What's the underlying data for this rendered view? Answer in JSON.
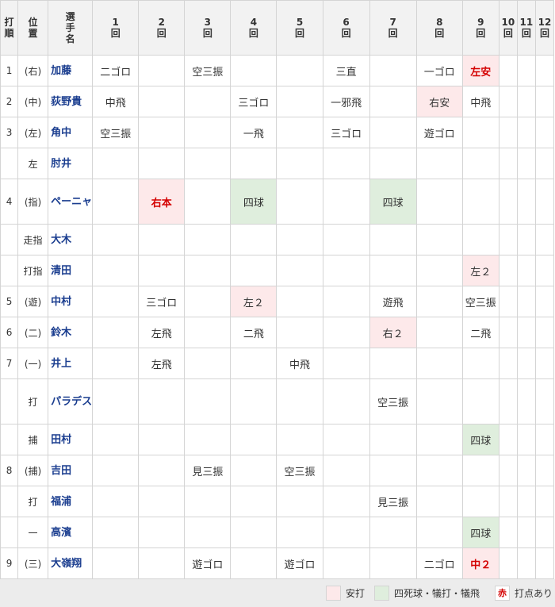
{
  "header": {
    "order": [
      "打",
      "順"
    ],
    "pos": [
      "位",
      "置"
    ],
    "name": [
      "選",
      "手",
      "名"
    ],
    "innings": [
      [
        "1",
        "回"
      ],
      [
        "2",
        "回"
      ],
      [
        "3",
        "回"
      ],
      [
        "4",
        "回"
      ],
      [
        "5",
        "回"
      ],
      [
        "6",
        "回"
      ],
      [
        "7",
        "回"
      ],
      [
        "8",
        "回"
      ],
      [
        "9",
        "回"
      ],
      [
        "10",
        "回"
      ],
      [
        "11",
        "回"
      ],
      [
        "12",
        "回"
      ]
    ]
  },
  "rows": [
    {
      "order": "1",
      "pos": "(右)",
      "name": "加藤",
      "tall": false,
      "cells": [
        {
          "t": "二ゴロ"
        },
        {
          "t": ""
        },
        {
          "t": "空三振"
        },
        {
          "t": ""
        },
        {
          "t": ""
        },
        {
          "t": "三直"
        },
        {
          "t": ""
        },
        {
          "t": "一ゴロ"
        },
        {
          "t": "左安",
          "k": "hit",
          "rbi": true
        },
        {
          "t": ""
        },
        {
          "t": ""
        },
        {
          "t": ""
        }
      ]
    },
    {
      "order": "2",
      "pos": "(中)",
      "name": "荻野貴",
      "tall": false,
      "cells": [
        {
          "t": "中飛"
        },
        {
          "t": ""
        },
        {
          "t": ""
        },
        {
          "t": "三ゴロ"
        },
        {
          "t": ""
        },
        {
          "t": "一邪飛"
        },
        {
          "t": ""
        },
        {
          "t": "右安",
          "k": "hit"
        },
        {
          "t": "中飛"
        },
        {
          "t": ""
        },
        {
          "t": ""
        },
        {
          "t": ""
        }
      ]
    },
    {
      "order": "3",
      "pos": "(左)",
      "name": "角中",
      "tall": false,
      "cells": [
        {
          "t": "空三振"
        },
        {
          "t": ""
        },
        {
          "t": ""
        },
        {
          "t": "一飛"
        },
        {
          "t": ""
        },
        {
          "t": "三ゴロ"
        },
        {
          "t": ""
        },
        {
          "t": "遊ゴロ"
        },
        {
          "t": ""
        },
        {
          "t": ""
        },
        {
          "t": ""
        },
        {
          "t": ""
        }
      ]
    },
    {
      "order": "",
      "pos": "左",
      "name": "肘井",
      "tall": false,
      "cells": [
        {
          "t": ""
        },
        {
          "t": ""
        },
        {
          "t": ""
        },
        {
          "t": ""
        },
        {
          "t": ""
        },
        {
          "t": ""
        },
        {
          "t": ""
        },
        {
          "t": ""
        },
        {
          "t": ""
        },
        {
          "t": ""
        },
        {
          "t": ""
        },
        {
          "t": ""
        }
      ]
    },
    {
      "order": "4",
      "pos": "(指)",
      "name": "ペーニャ",
      "tall": true,
      "cells": [
        {
          "t": ""
        },
        {
          "t": "右本",
          "k": "hit",
          "rbi": true
        },
        {
          "t": ""
        },
        {
          "t": "四球",
          "k": "walk"
        },
        {
          "t": ""
        },
        {
          "t": ""
        },
        {
          "t": "四球",
          "k": "walk"
        },
        {
          "t": ""
        },
        {
          "t": ""
        },
        {
          "t": ""
        },
        {
          "t": ""
        },
        {
          "t": ""
        }
      ]
    },
    {
      "order": "",
      "pos": "走指",
      "name": "大木",
      "tall": false,
      "cells": [
        {
          "t": ""
        },
        {
          "t": ""
        },
        {
          "t": ""
        },
        {
          "t": ""
        },
        {
          "t": ""
        },
        {
          "t": ""
        },
        {
          "t": ""
        },
        {
          "t": ""
        },
        {
          "t": ""
        },
        {
          "t": ""
        },
        {
          "t": ""
        },
        {
          "t": ""
        }
      ]
    },
    {
      "order": "",
      "pos": "打指",
      "name": "清田",
      "tall": false,
      "cells": [
        {
          "t": ""
        },
        {
          "t": ""
        },
        {
          "t": ""
        },
        {
          "t": ""
        },
        {
          "t": ""
        },
        {
          "t": ""
        },
        {
          "t": ""
        },
        {
          "t": ""
        },
        {
          "t": "左２",
          "k": "hit"
        },
        {
          "t": ""
        },
        {
          "t": ""
        },
        {
          "t": ""
        }
      ]
    },
    {
      "order": "5",
      "pos": "(遊)",
      "name": "中村",
      "tall": false,
      "cells": [
        {
          "t": ""
        },
        {
          "t": "三ゴロ"
        },
        {
          "t": ""
        },
        {
          "t": "左２",
          "k": "hit"
        },
        {
          "t": ""
        },
        {
          "t": ""
        },
        {
          "t": "遊飛"
        },
        {
          "t": ""
        },
        {
          "t": "空三振"
        },
        {
          "t": ""
        },
        {
          "t": ""
        },
        {
          "t": ""
        }
      ]
    },
    {
      "order": "6",
      "pos": "(二)",
      "name": "鈴木",
      "tall": false,
      "cells": [
        {
          "t": ""
        },
        {
          "t": "左飛"
        },
        {
          "t": ""
        },
        {
          "t": "二飛"
        },
        {
          "t": ""
        },
        {
          "t": ""
        },
        {
          "t": "右２",
          "k": "hit"
        },
        {
          "t": ""
        },
        {
          "t": "二飛"
        },
        {
          "t": ""
        },
        {
          "t": ""
        },
        {
          "t": ""
        }
      ]
    },
    {
      "order": "7",
      "pos": "(一)",
      "name": "井上",
      "tall": false,
      "cells": [
        {
          "t": ""
        },
        {
          "t": "左飛"
        },
        {
          "t": ""
        },
        {
          "t": ""
        },
        {
          "t": "中飛"
        },
        {
          "t": ""
        },
        {
          "t": ""
        },
        {
          "t": ""
        },
        {
          "t": ""
        },
        {
          "t": ""
        },
        {
          "t": ""
        },
        {
          "t": ""
        }
      ]
    },
    {
      "order": "",
      "pos": "打",
      "name": "パラデス",
      "tall": true,
      "cells": [
        {
          "t": ""
        },
        {
          "t": ""
        },
        {
          "t": ""
        },
        {
          "t": ""
        },
        {
          "t": ""
        },
        {
          "t": ""
        },
        {
          "t": "空三振"
        },
        {
          "t": ""
        },
        {
          "t": ""
        },
        {
          "t": ""
        },
        {
          "t": ""
        },
        {
          "t": ""
        }
      ]
    },
    {
      "order": "",
      "pos": "捕",
      "name": "田村",
      "tall": false,
      "cells": [
        {
          "t": ""
        },
        {
          "t": ""
        },
        {
          "t": ""
        },
        {
          "t": ""
        },
        {
          "t": ""
        },
        {
          "t": ""
        },
        {
          "t": ""
        },
        {
          "t": ""
        },
        {
          "t": "四球",
          "k": "walk"
        },
        {
          "t": ""
        },
        {
          "t": ""
        },
        {
          "t": ""
        }
      ]
    },
    {
      "order": "8",
      "pos": "(捕)",
      "name": "吉田",
      "tall": false,
      "cells": [
        {
          "t": ""
        },
        {
          "t": ""
        },
        {
          "t": "見三振"
        },
        {
          "t": ""
        },
        {
          "t": "空三振"
        },
        {
          "t": ""
        },
        {
          "t": ""
        },
        {
          "t": ""
        },
        {
          "t": ""
        },
        {
          "t": ""
        },
        {
          "t": ""
        },
        {
          "t": ""
        }
      ]
    },
    {
      "order": "",
      "pos": "打",
      "name": "福浦",
      "tall": false,
      "cells": [
        {
          "t": ""
        },
        {
          "t": ""
        },
        {
          "t": ""
        },
        {
          "t": ""
        },
        {
          "t": ""
        },
        {
          "t": ""
        },
        {
          "t": "見三振"
        },
        {
          "t": ""
        },
        {
          "t": ""
        },
        {
          "t": ""
        },
        {
          "t": ""
        },
        {
          "t": ""
        }
      ]
    },
    {
      "order": "",
      "pos": "一",
      "name": "高濱",
      "tall": false,
      "cells": [
        {
          "t": ""
        },
        {
          "t": ""
        },
        {
          "t": ""
        },
        {
          "t": ""
        },
        {
          "t": ""
        },
        {
          "t": ""
        },
        {
          "t": ""
        },
        {
          "t": ""
        },
        {
          "t": "四球",
          "k": "walk"
        },
        {
          "t": ""
        },
        {
          "t": ""
        },
        {
          "t": ""
        }
      ]
    },
    {
      "order": "9",
      "pos": "(三)",
      "name": "大嶺翔",
      "tall": false,
      "cells": [
        {
          "t": ""
        },
        {
          "t": ""
        },
        {
          "t": "遊ゴロ"
        },
        {
          "t": ""
        },
        {
          "t": "遊ゴロ"
        },
        {
          "t": ""
        },
        {
          "t": ""
        },
        {
          "t": "二ゴロ"
        },
        {
          "t": "中２",
          "k": "hit",
          "rbi": true
        },
        {
          "t": ""
        },
        {
          "t": ""
        },
        {
          "t": ""
        }
      ]
    }
  ],
  "legend": {
    "hit_label": "安打",
    "walk_label": "四死球・犠打・犠飛",
    "rbi_swatch": "赤",
    "rbi_label": "打点あり"
  },
  "colors": {
    "hit_bg": "#fde9ea",
    "walk_bg": "#dfeedd",
    "rbi_text": "#d40000",
    "name_text": "#1a3d8f"
  }
}
